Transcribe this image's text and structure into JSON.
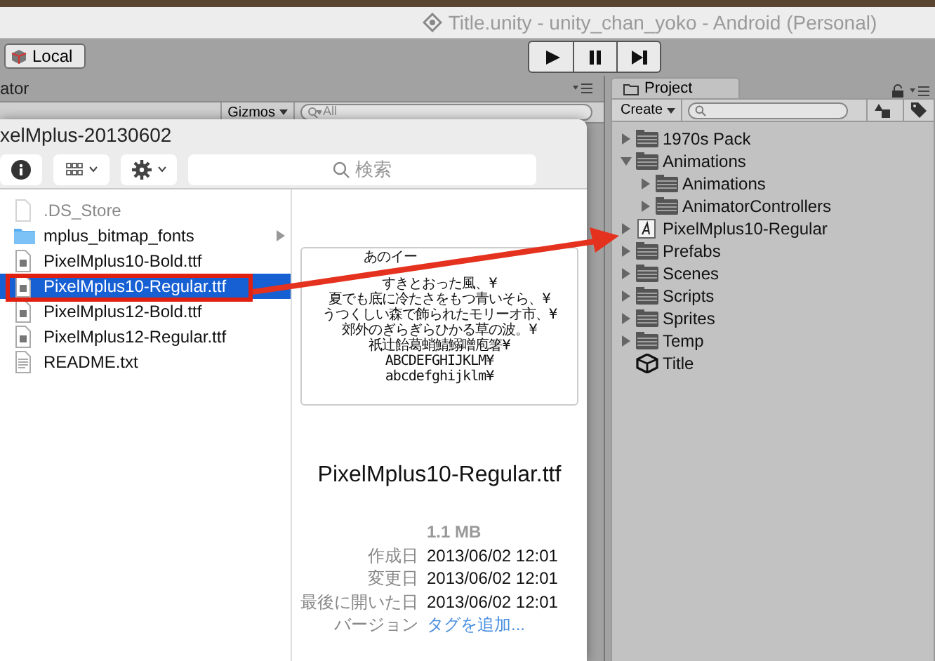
{
  "window": {
    "title": "Title.unity - unity_chan_yoko - Android (Personal)"
  },
  "toolbar": {
    "pivot_button": "Local",
    "play_buttons": [
      {
        "kind": "play"
      },
      {
        "kind": "pause"
      },
      {
        "kind": "step"
      }
    ]
  },
  "left_panel": {
    "tab": "ator",
    "gizmos": "Gizmos",
    "search": {
      "placeholder": "All"
    }
  },
  "finder": {
    "title": "xelMplus-20130602",
    "search": {
      "placeholder": "検索"
    },
    "files": [
      {
        "name": ".DS_Store",
        "kind": "document",
        "dimmed": true,
        "selected": false
      },
      {
        "name": "mplus_bitmap_fonts",
        "kind": "folder",
        "dimmed": false,
        "selected": false
      },
      {
        "name": "PixelMplus10-Bold.ttf",
        "kind": "font",
        "dimmed": false,
        "selected": false
      },
      {
        "name": "PixelMplus10-Regular.ttf",
        "kind": "font",
        "dimmed": false,
        "selected": true
      },
      {
        "name": "PixelMplus12-Bold.ttf",
        "kind": "font",
        "dimmed": false,
        "selected": false
      },
      {
        "name": "PixelMplus12-Regular.ttf",
        "kind": "font",
        "dimmed": false,
        "selected": false
      },
      {
        "name": "README.txt",
        "kind": "text",
        "dimmed": false,
        "selected": false
      }
    ],
    "preview_lines": [
      [
        "あのイー"
      ],
      [
        "すきとおった風、¥"
      ],
      [
        "夏でも底に冷たさをもつ青いそら、¥"
      ],
      [
        "うつくしい森で飾られたモリーオ市、¥"
      ],
      [
        "郊外のぎらぎらひかる草の波。¥"
      ],
      [
        "祇辻飴葛蛸鯖鰯噌庖箸¥"
      ],
      [
        "ABCDEFGHIJKLM¥"
      ],
      [
        "abcdefghijklm¥"
      ]
    ],
    "file_name": "PixelMplus10-Regular.ttf",
    "size": "1.1 MB",
    "info": [
      {
        "label": "作成日",
        "value": "2013/06/02 12:01",
        "kind": "text"
      },
      {
        "label": "変更日",
        "value": "2013/06/02 12:01",
        "kind": "text"
      },
      {
        "label": "最後に開いた日",
        "value": "2013/06/02 12:01",
        "kind": "text"
      },
      {
        "label": "バージョン",
        "value": "タグを追加...",
        "kind": "link"
      }
    ]
  },
  "project": {
    "tab": "Project",
    "create_button": "Create",
    "items": [
      {
        "name": "1970s Pack",
        "kind": "folder",
        "expanded": false
      },
      {
        "name": "Animations",
        "kind": "folder",
        "expanded": true,
        "children": [
          {
            "name": "Animations",
            "kind": "folder",
            "expanded": false
          },
          {
            "name": "AnimatorControllers",
            "kind": "folder",
            "expanded": false
          }
        ]
      },
      {
        "name": "PixelMplus10-Regular",
        "kind": "font",
        "expanded": false
      },
      {
        "name": "Prefabs",
        "kind": "folder",
        "expanded": false
      },
      {
        "name": "Scenes",
        "kind": "folder",
        "expanded": false
      },
      {
        "name": "Scripts",
        "kind": "folder",
        "expanded": false
      },
      {
        "name": "Sprites",
        "kind": "folder",
        "expanded": false
      },
      {
        "name": "Temp",
        "kind": "folder",
        "expanded": false
      },
      {
        "name": "Title",
        "kind": "scene"
      }
    ]
  }
}
